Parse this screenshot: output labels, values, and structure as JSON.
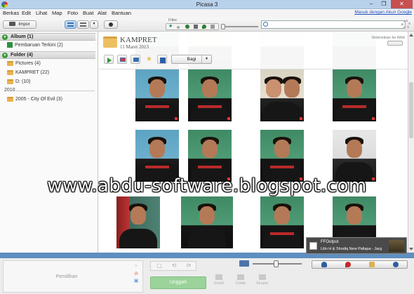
{
  "window": {
    "title": "Picasa 3",
    "minimize_glyph": "–",
    "maximize_glyph": "❐",
    "close_glyph": "✕"
  },
  "menu": {
    "items": [
      "Berkas",
      "Edit",
      "Lihat",
      "Map",
      "Foto",
      "Buat",
      "Alat",
      "Bantuan"
    ],
    "signin": "Masuk dengan Akun Google"
  },
  "toolbar": {
    "import_label": "Impor",
    "filter_label": "Filter"
  },
  "search": {
    "placeholder": ""
  },
  "sidebar": {
    "album_section": "Album (1)",
    "album_items": [
      "Pembaruan Terkini (2)"
    ],
    "folder_section": "Folder (4)",
    "folder_items": [
      "Pictures (4)",
      "KAMPRET (22)",
      "D: (10)"
    ],
    "year_group": "2010",
    "year_items": [
      "2005 -  City Of Evil (3)"
    ],
    "toggle_glyph": "▼"
  },
  "folder_header": {
    "name": "KAMPRET",
    "date": "11 Maret 2013",
    "sync_label": "Sinkronkan ke Web",
    "share_label": "Bagi",
    "share_caret": "▼"
  },
  "notification": {
    "title": "FFOutput",
    "text": "Lilin H & Shodiq New Pallapa - Jarg"
  },
  "watermark": "www.abdu-software.blogspot.com",
  "bottom": {
    "selection_label": "Pemilihan",
    "upload_label": "Unggah",
    "actions": [
      "Email",
      "Cetak",
      "Ekspor"
    ],
    "rotate_glyphs": [
      "⟲",
      "⟳"
    ]
  },
  "colors": {
    "accent_blue": "#5e8fc0",
    "title_bar": "#b9d2ec",
    "upload_green": "#9bd39b",
    "close_red": "#c75050"
  }
}
